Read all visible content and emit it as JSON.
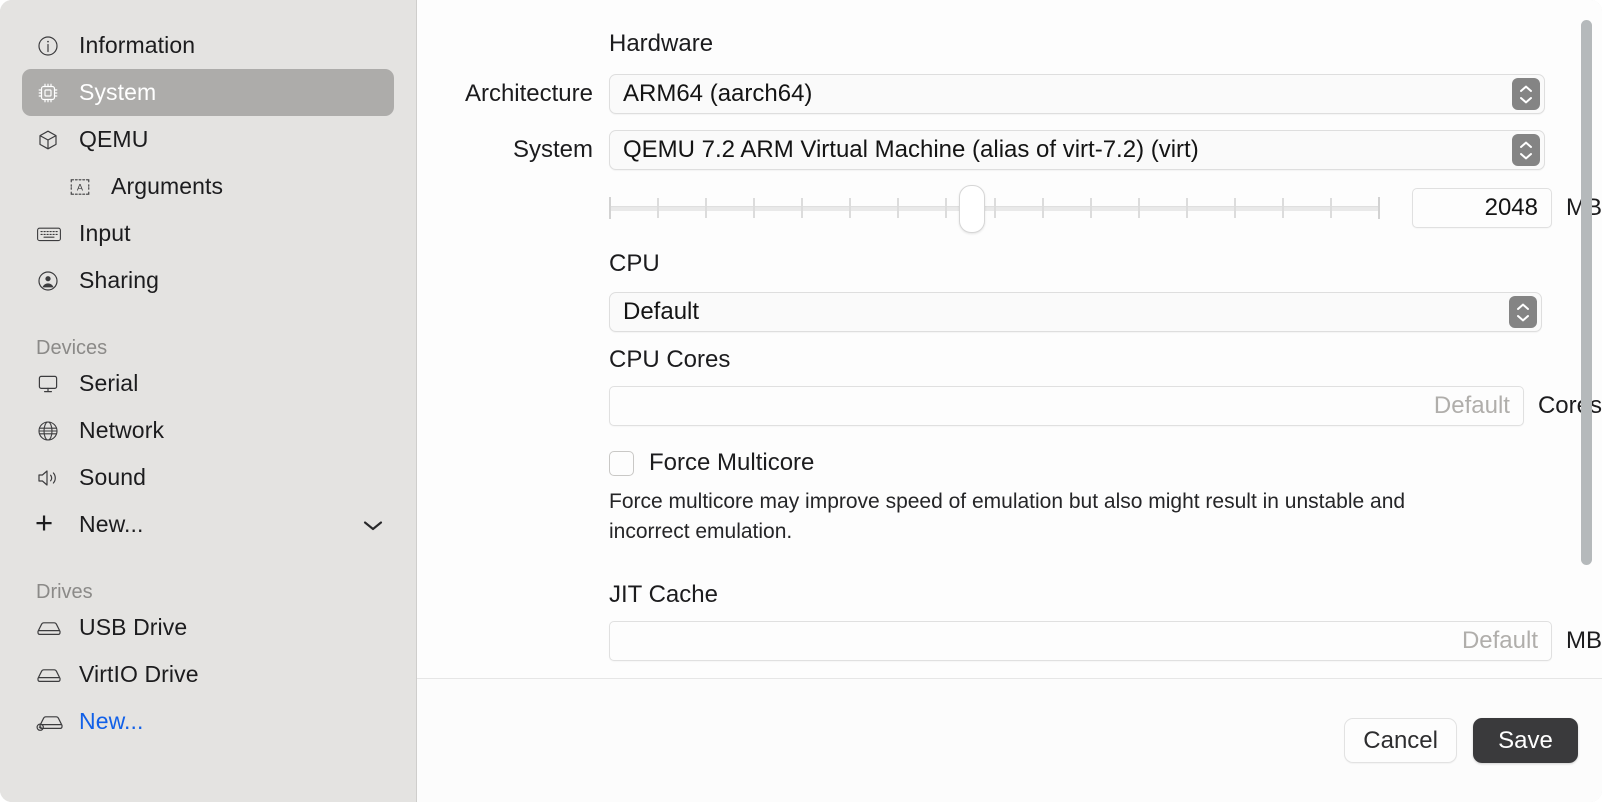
{
  "sidebar": {
    "items": [
      {
        "label": "Information",
        "icon": "info-circle-icon",
        "selected": false,
        "indent": false
      },
      {
        "label": "System",
        "icon": "cpu-chip-icon",
        "selected": true,
        "indent": false
      },
      {
        "label": "QEMU",
        "icon": "cube-box-icon",
        "selected": false,
        "indent": false
      },
      {
        "label": "Arguments",
        "icon": "argument-a-icon",
        "selected": false,
        "indent": true
      },
      {
        "label": "Input",
        "icon": "keyboard-icon",
        "selected": false,
        "indent": false
      },
      {
        "label": "Sharing",
        "icon": "person-circle-icon",
        "selected": false,
        "indent": false
      }
    ],
    "devices_header": "Devices",
    "devices": [
      {
        "label": "Serial",
        "icon": "display-icon"
      },
      {
        "label": "Network",
        "icon": "globe-icon"
      },
      {
        "label": "Sound",
        "icon": "speaker-icon"
      }
    ],
    "devices_new": {
      "label": "New...",
      "icon": "plus-icon",
      "chevron": "chevron-down-icon"
    },
    "drives_header": "Drives",
    "drives": [
      {
        "label": "USB Drive",
        "icon": "drive-icon"
      },
      {
        "label": "VirtIO Drive",
        "icon": "drive-icon"
      }
    ],
    "drives_new": {
      "label": "New...",
      "icon": "drive-add-icon"
    }
  },
  "main": {
    "hardware": {
      "title": "Hardware",
      "architecture_label": "Architecture",
      "architecture_value": "ARM64 (aarch64)",
      "system_label": "System",
      "system_value": "QEMU 7.2 ARM Virtual Machine (alias of virt-7.2) (virt)",
      "memory_value": "2048",
      "memory_unit": "MB",
      "memory_slider_percent": 47,
      "memory_slider_ticks": 17
    },
    "cpu": {
      "title": "CPU",
      "cpu_value": "Default",
      "cores_title": "CPU Cores",
      "cores_placeholder": "Default",
      "cores_unit": "Cores",
      "force_multicore_label": "Force Multicore",
      "force_multicore_checked": false,
      "force_multicore_help": "Force multicore may improve speed of emulation but also might result in unstable and incorrect emulation."
    },
    "jit": {
      "title": "JIT Cache",
      "placeholder": "Default",
      "unit": "MB"
    }
  },
  "footer": {
    "cancel_label": "Cancel",
    "save_label": "Save"
  },
  "colors": {
    "sidebar_bg": "#e4e3e1",
    "selection": "#adacaa",
    "link": "#1160e8",
    "save_bg": "#3a3a3c",
    "stepper_bg": "#848484"
  }
}
